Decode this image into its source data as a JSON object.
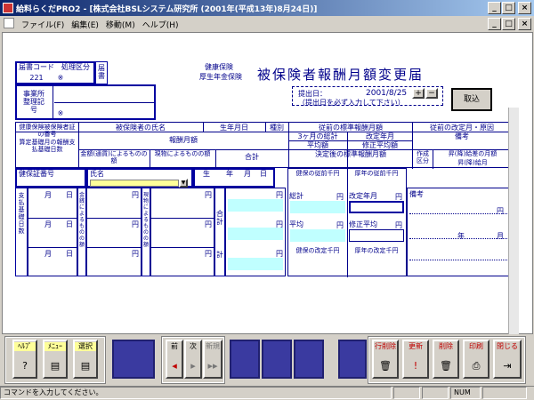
{
  "window": {
    "title": "給料らくだPRO2 - [株式会社BSLシステム研究所 (2001年(平成13年)8月24日)]",
    "min": "_",
    "max": "□",
    "close": "×"
  },
  "menu": [
    "ファイル(F)",
    "編集(E)",
    "移動(M)",
    "ヘルプ(H)"
  ],
  "form": {
    "title": "被保険者報酬月額変更届",
    "org1": "健康保険",
    "org2": "厚生年金保険",
    "office_code_label": "届書コード",
    "office_code": "221",
    "proc_label": "処理区分",
    "proc_value": "※",
    "stamp_label": "届書",
    "jigyosho_label": "事業所整理記号",
    "jigyosho_mark": "※",
    "submit_label": "提出日：",
    "submit_date": "2001/8/25",
    "plus": "+",
    "minus": "−",
    "submit_note": "（提出日を必ず入力して下さい）",
    "import_button": "取込",
    "h1": {
      "c1": "健康保険被保険者証の番号",
      "c2": "被保険者の氏名",
      "c3": "生年月日",
      "c4": "種別",
      "c5": "従前の標準報酬月額",
      "c6": "従前の改定月・原因"
    },
    "h2": {
      "c1": "算定基礎月の報酬支払基礎日数",
      "c2": "報酬月額",
      "c3": "3ヶ月の総計",
      "c4": "改定年月",
      "c5": "備考"
    },
    "h3": {
      "c1": "金額(通貨)によるものの額",
      "c2": "現物によるものの額",
      "c3": "合計",
      "c4": "平均額",
      "c5": "修正平均額",
      "c6": "決定後の標準報酬月額",
      "c7": "昇(降)給差の月額",
      "c8": "昇(降)給月",
      "c9": "作成区分"
    },
    "row": {
      "hoken_label": "健保証番号",
      "name_label": "氏名",
      "birth_label": "生年月日",
      "sei": "生",
      "nen": "年",
      "tsuki": "月",
      "hi": "日",
      "kenpo_prev": "健保の従前千円",
      "kosei_prev": "厚年の従前千円",
      "sokei": "総計",
      "kaitei": "改定年月",
      "heikin": "平均",
      "shusei": "修正平均",
      "kenpo_new": "健保の改定千円",
      "kosei_new": "厚年の改定千円",
      "bikou": "備考",
      "yen": "円",
      "nen2": "年",
      "tsuki2": "月",
      "side1": "支払基礎日数",
      "side2": "金銭によるものの額",
      "side3": "現物によるものの額",
      "goukei": "合計",
      "kei": "計"
    }
  },
  "toolbar": {
    "help": "ﾍﾙﾌﾟ",
    "menu": "ﾒﾆｭｰ",
    "select": "選択",
    "prev": "前",
    "next": "次",
    "new": "新規",
    "row_delete": "行削除",
    "update": "更新",
    "delete": "削除",
    "print": "印刷",
    "close": "閉じる"
  },
  "status": {
    "message": "コマンドを入力してください。",
    "num": "NUM"
  }
}
